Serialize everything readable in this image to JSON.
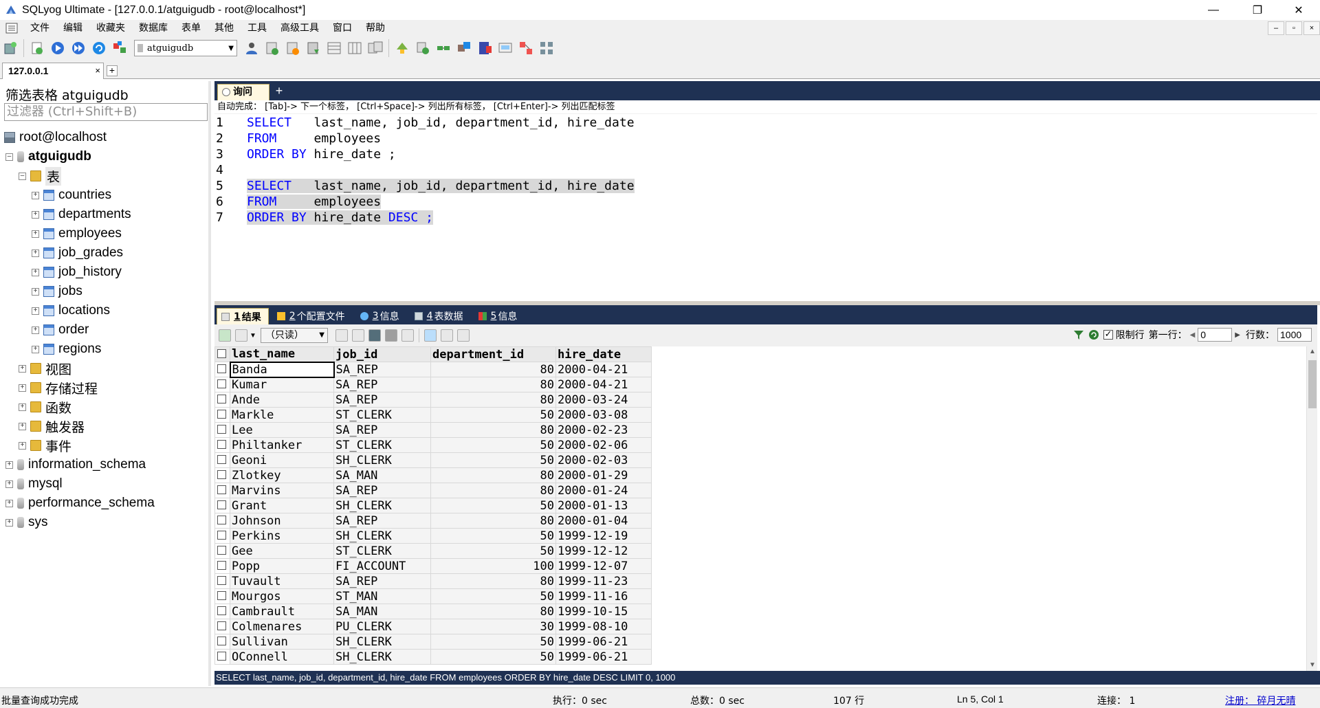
{
  "window": {
    "title": "SQLyog Ultimate - [127.0.0.1/atguigudb - root@localhost*]",
    "minimize": "—",
    "maximize": "❐",
    "close": "✕"
  },
  "menu": {
    "items": [
      "文件",
      "编辑",
      "收藏夹",
      "数据库",
      "表单",
      "其他",
      "工具",
      "高级工具",
      "窗口",
      "帮助"
    ],
    "mdi_buttons": [
      "–",
      "▫",
      "×"
    ]
  },
  "toolbar": {
    "database_selected": "atguigudb"
  },
  "connection_tab": {
    "label": "127.0.0.1",
    "close": "×",
    "add": "+"
  },
  "object_browser": {
    "filter_label": "筛选表格 atguigudb",
    "filter_placeholder": "过滤器 (Ctrl+Shift+B)",
    "server": "root@localhost",
    "database": "atguigudb",
    "tables_folder": "表",
    "tables": [
      "countries",
      "departments",
      "employees",
      "job_grades",
      "job_history",
      "jobs",
      "locations",
      "order",
      "regions"
    ],
    "folders": [
      "视图",
      "存储过程",
      "函数",
      "触发器",
      "事件"
    ],
    "other_databases": [
      "information_schema",
      "mysql",
      "performance_schema",
      "sys"
    ]
  },
  "query": {
    "tab_label": "询问",
    "add": "+",
    "autocomplete_hint": "自动完成： [Tab]-> 下一个标签， [Ctrl+Space]-> 列出所有标签， [Ctrl+Enter]-> 列出匹配标签",
    "lines": [
      {
        "n": "1",
        "kw": "SELECT",
        "rest": "   last_name, job_id, department_id, hire_date"
      },
      {
        "n": "2",
        "kw": "FROM",
        "rest": "     employees"
      },
      {
        "n": "3",
        "kw": "ORDER BY",
        "rest": " hire_date ;"
      },
      {
        "n": "4",
        "kw": "",
        "rest": ""
      },
      {
        "n": "5",
        "kw": "SELECT",
        "rest": "   last_name, job_id, department_id, hire_date"
      },
      {
        "n": "6",
        "kw": "FROM",
        "rest": "     employees"
      },
      {
        "n": "7",
        "kw": "ORDER BY",
        "rest": " hire_date ",
        "kw2": "DESC",
        "rest2": " ;"
      }
    ]
  },
  "result_tabs": [
    {
      "num": "1",
      "label": "结果"
    },
    {
      "num": "2",
      "label": "个配置文件"
    },
    {
      "num": "3",
      "label": "信息"
    },
    {
      "num": "4",
      "label": "表数据"
    },
    {
      "num": "5",
      "label": "信息"
    }
  ],
  "result_toolbar": {
    "mode": "（只读）",
    "limit_label": "限制行",
    "first_row_label": "第一行：",
    "first_row_value": "0",
    "rows_label": "行数：",
    "rows_value": "1000"
  },
  "result_grid": {
    "columns": [
      "last_name",
      "job_id",
      "department_id",
      "hire_date"
    ],
    "rows": [
      [
        "Banda",
        "SA_REP",
        "80",
        "2000-04-21"
      ],
      [
        "Kumar",
        "SA_REP",
        "80",
        "2000-04-21"
      ],
      [
        "Ande",
        "SA_REP",
        "80",
        "2000-03-24"
      ],
      [
        "Markle",
        "ST_CLERK",
        "50",
        "2000-03-08"
      ],
      [
        "Lee",
        "SA_REP",
        "80",
        "2000-02-23"
      ],
      [
        "Philtanker",
        "ST_CLERK",
        "50",
        "2000-02-06"
      ],
      [
        "Geoni",
        "SH_CLERK",
        "50",
        "2000-02-03"
      ],
      [
        "Zlotkey",
        "SA_MAN",
        "80",
        "2000-01-29"
      ],
      [
        "Marvins",
        "SA_REP",
        "80",
        "2000-01-24"
      ],
      [
        "Grant",
        "SH_CLERK",
        "50",
        "2000-01-13"
      ],
      [
        "Johnson",
        "SA_REP",
        "80",
        "2000-01-04"
      ],
      [
        "Perkins",
        "SH_CLERK",
        "50",
        "1999-12-19"
      ],
      [
        "Gee",
        "ST_CLERK",
        "50",
        "1999-12-12"
      ],
      [
        "Popp",
        "FI_ACCOUNT",
        "100",
        "1999-12-07"
      ],
      [
        "Tuvault",
        "SA_REP",
        "80",
        "1999-11-23"
      ],
      [
        "Mourgos",
        "ST_MAN",
        "50",
        "1999-11-16"
      ],
      [
        "Cambrault",
        "SA_MAN",
        "80",
        "1999-10-15"
      ],
      [
        "Colmenares",
        "PU_CLERK",
        "30",
        "1999-08-10"
      ],
      [
        "Sullivan",
        "SH_CLERK",
        "50",
        "1999-06-21"
      ],
      [
        "OConnell",
        "SH_CLERK",
        "50",
        "1999-06-21"
      ]
    ]
  },
  "sql_status": "SELECT last_name, job_id, department_id, hire_date FROM employees ORDER BY hire_date DESC LIMIT 0, 1000",
  "statusbar": {
    "message": "批量查询成功完成",
    "exec": "执行：0 sec",
    "total": "总数：0 sec",
    "rows": "107 行",
    "position": "Ln 5, Col 1",
    "connections": "连接： 1",
    "register": "注册： 碎月无晴"
  },
  "colors": {
    "dark_header": "#1f3153",
    "keyword": "#0000ff",
    "selection": "#d8d8d8"
  }
}
